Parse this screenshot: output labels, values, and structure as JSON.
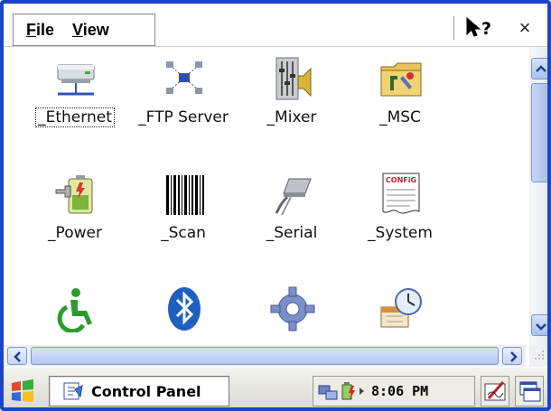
{
  "menu": {
    "file_label": "File",
    "view_label": "View",
    "help_icon": "help-pointer-icon",
    "close_label": "×"
  },
  "icons": [
    {
      "label": "_Ethernet",
      "icon": "ethernet-icon"
    },
    {
      "label": "_FTP Server",
      "icon": "ftp-server-icon"
    },
    {
      "label": "_Mixer",
      "icon": "mixer-icon"
    },
    {
      "label": "_MSC",
      "icon": "msc-icon"
    },
    {
      "label": "_Power",
      "icon": "power-icon"
    },
    {
      "label": "_Scan",
      "icon": "barcode-icon"
    },
    {
      "label": "_Serial",
      "icon": "serial-cable-icon"
    },
    {
      "label": "_System",
      "icon": "config-icon"
    },
    {
      "label": "",
      "icon": "accessibility-icon"
    },
    {
      "label": "",
      "icon": "bluetooth-icon"
    },
    {
      "label": "",
      "icon": "gear-icon"
    },
    {
      "label": "",
      "icon": "date-time-icon"
    }
  ],
  "taskbar": {
    "app_label": "Control Panel",
    "clock": "8:06 PM"
  },
  "colors": {
    "frame": "#1a45c8",
    "scrollbar": "#aac0ee"
  }
}
